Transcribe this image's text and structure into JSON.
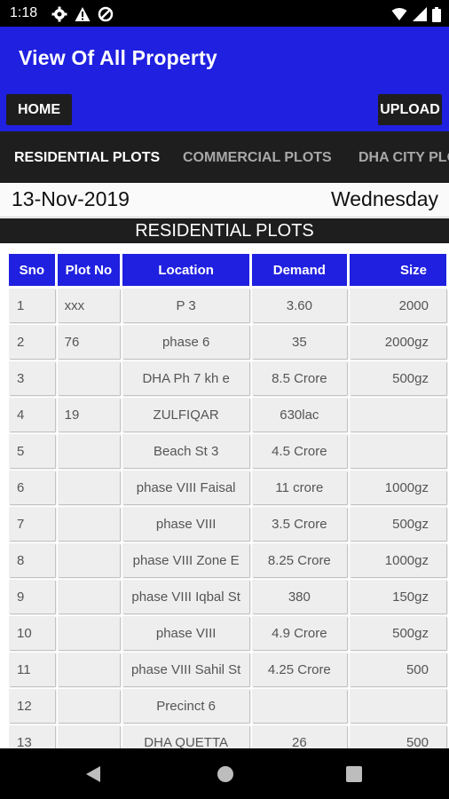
{
  "status": {
    "time": "1:18",
    "icons": [
      "gear-icon",
      "warning-icon",
      "data-saver-icon",
      "wifi-icon",
      "signal-icon",
      "battery-icon"
    ]
  },
  "header": {
    "title": "View Of All Property",
    "home_label": "HOME",
    "upload_label": "UPLOAD"
  },
  "tabs": [
    {
      "label": "RESIDENTIAL PLOTS",
      "active": true
    },
    {
      "label": "COMMERCIAL PLOTS",
      "active": false
    },
    {
      "label": "DHA CITY PLOTS",
      "active": false
    }
  ],
  "date": {
    "date": "13-Nov-2019",
    "day": "Wednesday"
  },
  "section_title": "RESIDENTIAL PLOTS",
  "table": {
    "headers": [
      "Sno",
      "Plot No",
      "Location",
      "Demand",
      "Size"
    ],
    "rows": [
      [
        "1",
        "xxx",
        "P 3",
        "3.60",
        "2000"
      ],
      [
        "2",
        "76",
        "phase 6",
        "35",
        "2000gz"
      ],
      [
        "3",
        "",
        "DHA Ph 7 kh e",
        "8.5 Crore",
        "500gz"
      ],
      [
        "4",
        "19",
        "ZULFIQAR",
        "630lac",
        ""
      ],
      [
        "5",
        "",
        "Beach St 3",
        "4.5 Crore",
        ""
      ],
      [
        "6",
        "",
        "phase VIII Faisal",
        "11 crore",
        "1000gz"
      ],
      [
        "7",
        "",
        "phase VIII",
        "3.5 Crore",
        "500gz"
      ],
      [
        "8",
        "",
        "phase VIII Zone E",
        "8.25 Crore",
        "1000gz"
      ],
      [
        "9",
        "",
        "phase VIII Iqbal St",
        "380",
        "150gz"
      ],
      [
        "10",
        "",
        "phase VIII",
        "4.9 Crore",
        "500gz"
      ],
      [
        "11",
        "",
        "phase VIII Sahil St",
        "4.25 Crore",
        "500"
      ],
      [
        "12",
        "",
        "Precinct 6",
        "",
        ""
      ],
      [
        "13",
        "",
        "DHA QUETTA",
        "26",
        "500"
      ]
    ]
  },
  "colors": {
    "primary": "#2020e0",
    "dark": "#1e1e1e",
    "cell": "#eeeeee"
  }
}
